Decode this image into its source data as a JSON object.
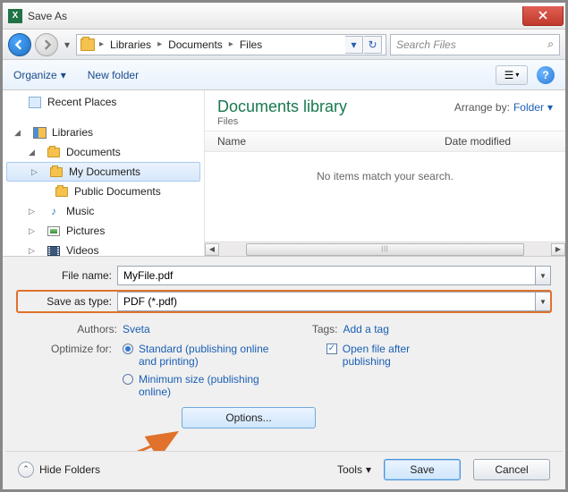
{
  "titlebar": {
    "title": "Save As"
  },
  "breadcrumb": {
    "items": [
      "Libraries",
      "Documents",
      "Files"
    ]
  },
  "search": {
    "placeholder": "Search Files"
  },
  "toolbar": {
    "organize": "Organize",
    "newfolder": "New folder"
  },
  "sidebar": {
    "recent": "Recent Places",
    "libraries": "Libraries",
    "documents": "Documents",
    "mydocs": "My Documents",
    "publicdocs": "Public Documents",
    "music": "Music",
    "pictures": "Pictures",
    "videos": "Videos"
  },
  "content": {
    "title": "Documents library",
    "subtitle": "Files",
    "arrange_label": "Arrange by:",
    "arrange_value": "Folder",
    "col_name": "Name",
    "col_date": "Date modified",
    "empty": "No items match your search."
  },
  "form": {
    "filename_label": "File name:",
    "filename_value": "MyFile.pdf",
    "saveas_label": "Save as type:",
    "saveas_value": "PDF (*.pdf)",
    "authors_label": "Authors:",
    "authors_value": "Sveta",
    "tags_label": "Tags:",
    "tags_value": "Add a tag",
    "optimize_label": "Optimize for:",
    "opt_standard": "Standard (publishing online and printing)",
    "opt_minimum": "Minimum size (publishing online)",
    "open_after": "Open file after publishing",
    "options_btn": "Options..."
  },
  "footer": {
    "hide": "Hide Folders",
    "tools": "Tools",
    "save": "Save",
    "cancel": "Cancel"
  }
}
